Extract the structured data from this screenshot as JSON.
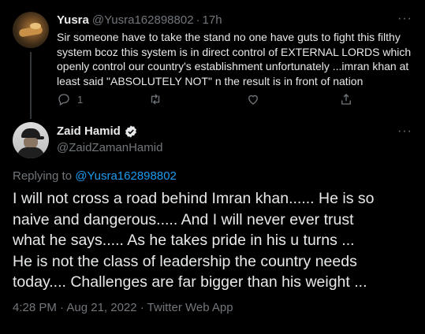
{
  "reply_tweet": {
    "name": "Yusra",
    "handle": "@Yusra162898802",
    "separator": "·",
    "time": "17h",
    "more_label": "···",
    "text": "Sir someone have to take the stand no one have guts to fight this filthy\nsystem bcoz this system is in direct control of EXTERNAL LORDS which\nopenly control our country's establishment unfortunately  ...imran khan at\nleast said \"ABSOLUTELY NOT\" n the result is in front of nation",
    "reply_count": "1"
  },
  "main_tweet": {
    "name": "Zaid Hamid",
    "handle": "@ZaidZamanHamid",
    "more_label": "···",
    "replying_prefix": "Replying to ",
    "replying_handle": "@Yusra162898802",
    "text": "I will not cross a road behind Imran khan...... He is so\nnaive and dangerous..... And I will never ever trust\nwhat he says..... As he takes pride in his u turns ...\nHe is not the class of leadership the country needs\ntoday.... Challenges are far bigger than his weight ...",
    "meta": "4:28 PM · Aug 21, 2022 · Twitter Web App"
  },
  "colors": {
    "background": "#000000",
    "text": "#e7e9ea",
    "muted": "#71767b",
    "link": "#1d9bf0",
    "divider": "#2f3336"
  },
  "icons": [
    "reply-icon",
    "retweet-icon",
    "like-icon",
    "share-icon",
    "verified-badge-icon",
    "more-icon"
  ]
}
